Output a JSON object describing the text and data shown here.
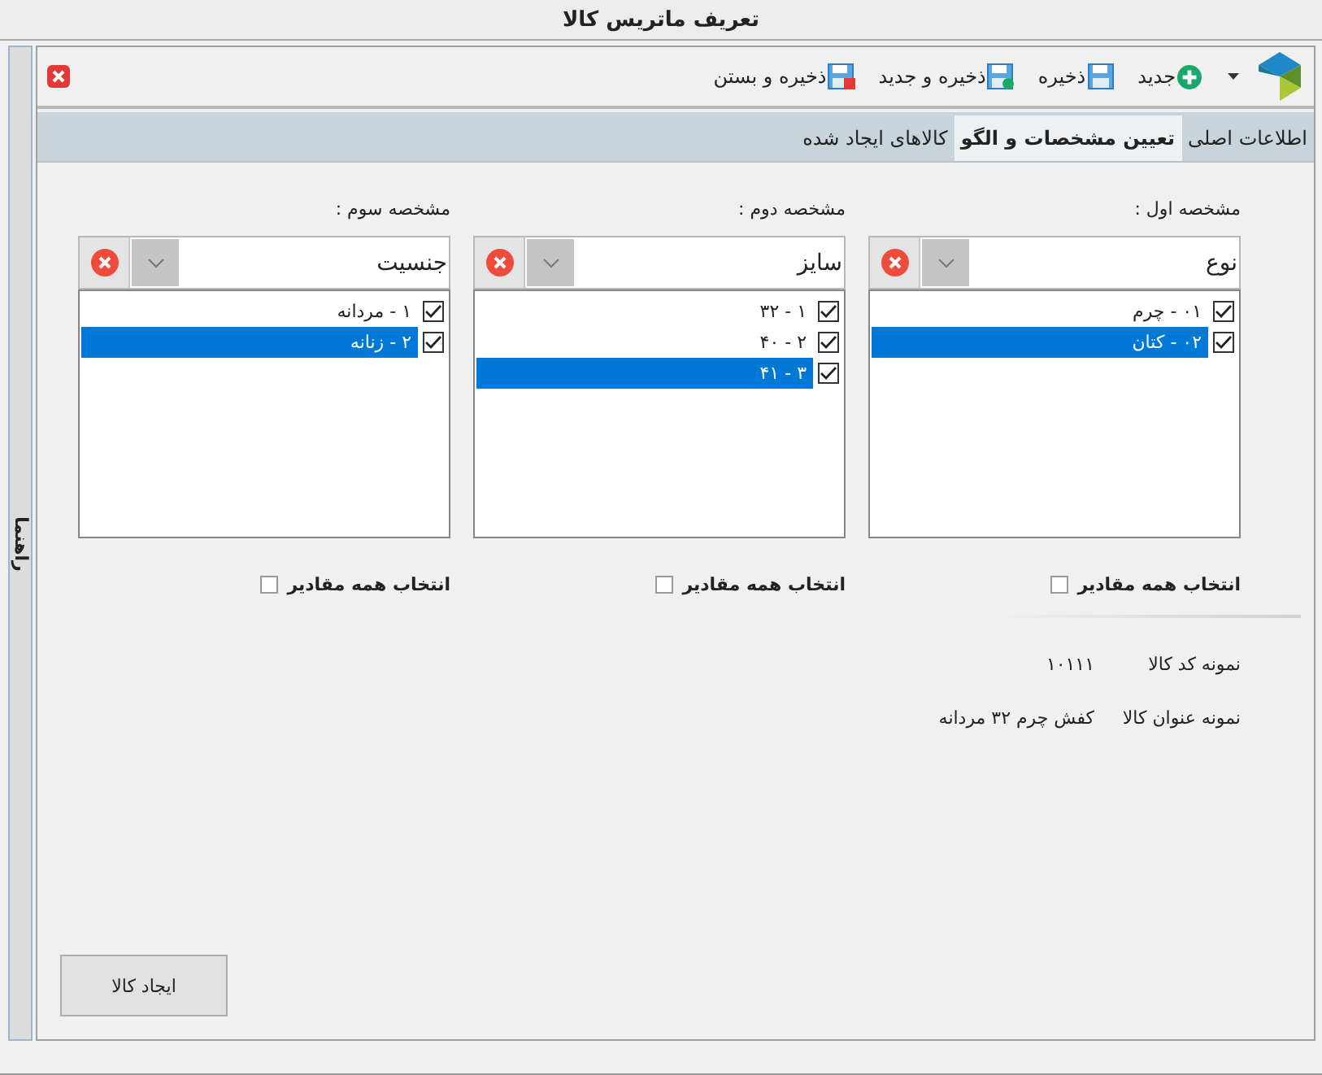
{
  "window": {
    "title": "تعریف ماتریس کالا"
  },
  "side_tab": {
    "label": "راهنما"
  },
  "toolbar": [
    {
      "label": "جدید",
      "kind": "new"
    },
    {
      "label": "ذخیره",
      "kind": "save"
    },
    {
      "label": "ذخیره و جدید",
      "kind": "save_new"
    },
    {
      "label": "ذخیره و بستن",
      "kind": "save_close"
    }
  ],
  "tabs": [
    {
      "label": "اطلاعات اصلی",
      "selected": false
    },
    {
      "label": "تعیین مشخصات و الگو",
      "selected": true
    },
    {
      "label": "کالاهای ایجاد شده",
      "selected": false
    }
  ],
  "attributes": [
    {
      "label": "مشخصه اول :",
      "value": "نوع",
      "items": [
        {
          "text": "۰۱ - چرم",
          "checked": true,
          "selected": false
        },
        {
          "text": "۰۲ - کتان",
          "checked": true,
          "selected": true
        }
      ],
      "select_all": {
        "label": "انتخاب همه مقادیر",
        "checked": false
      }
    },
    {
      "label": "مشخصه دوم :",
      "value": "سایز",
      "items": [
        {
          "text": "۱ - ۳۲",
          "checked": true,
          "selected": false
        },
        {
          "text": "۲ - ۴۰",
          "checked": true,
          "selected": false
        },
        {
          "text": "۳ - ۴۱",
          "checked": true,
          "selected": true
        }
      ],
      "select_all": {
        "label": "انتخاب همه مقادیر",
        "checked": false
      }
    },
    {
      "label": "مشخصه سوم :",
      "value": "جنسیت",
      "items": [
        {
          "text": "۱ - مردانه",
          "checked": true,
          "selected": false
        },
        {
          "text": "۲ - زنانه",
          "checked": true,
          "selected": true
        }
      ],
      "select_all": {
        "label": "انتخاب همه مقادیر",
        "checked": false
      }
    }
  ],
  "samples": [
    {
      "label": "نمونه کد کالا",
      "value": "۱۰۱۱۱"
    },
    {
      "label": "نمونه عنوان کالا",
      "value": "کفش چرم ۳۲ مردانه"
    }
  ],
  "create_button": {
    "label": "ایجاد کالا"
  }
}
